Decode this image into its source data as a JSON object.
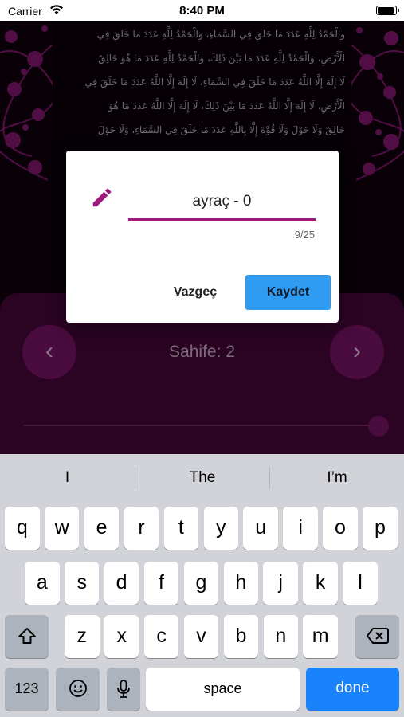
{
  "status_bar": {
    "carrier": "Carrier",
    "time": "8:40 PM"
  },
  "reader": {
    "arabic_lines": [
      "وَالْحَمْدُ لِلَّهِ عَدَدَ مَا خَلَقَ فِي السَّمَاءِ، وَالْحَمْدُ لِلَّهِ عَدَدَ مَا خَلَقَ فِي",
      "الْأَرْضِ، وَالْحَمْدُ لِلَّهِ عَدَدَ مَا بَيْنَ ذَلِكَ، وَالْحَمْدُ لِلَّهِ عَدَدَ مَا هُوَ خَالِقٌ",
      "لَا إِلَهَ إِلَّا اللَّهُ عَدَدَ مَا خَلَقَ فِي السَّمَاءِ، لَا إِلَهَ إِلَّا اللَّهُ عَدَدَ مَا خَلَقَ فِي",
      "الْأَرْضِ، لَا إِلَهَ إِلَّا اللَّهُ عَدَدَ مَا بَيْنَ ذَلِكَ، لَا إِلَهَ إِلَّا اللَّهُ عَدَدَ مَا هُوَ",
      "خَالِقٌ وَلَا حَوْلَ وَلَا قُوَّةَ إِلَّا بِاللَّهِ عَدَدَ مَا خَلَقَ فِي السَّمَاءِ، وَلَا حَوْلَ"
    ]
  },
  "panel": {
    "page_label": "Sahife: 2",
    "prev_icon": "‹",
    "next_icon": "›",
    "page_progress": 1.0
  },
  "dialog": {
    "input_value": "ayraç - 0",
    "char_count": "9/25",
    "cancel_label": "Vazgeç",
    "save_label": "Kaydet",
    "accent_color": "#9c1a7d",
    "save_color": "#2f9bf1"
  },
  "keyboard": {
    "suggestions": [
      "I",
      "The",
      "I’m"
    ],
    "row1": [
      "q",
      "w",
      "e",
      "r",
      "t",
      "y",
      "u",
      "i",
      "o",
      "p"
    ],
    "row2": [
      "a",
      "s",
      "d",
      "f",
      "g",
      "h",
      "j",
      "k",
      "l"
    ],
    "row3": [
      "z",
      "x",
      "c",
      "v",
      "b",
      "n",
      "m"
    ],
    "numbers_label": "123",
    "space_label": "space",
    "done_label": "done",
    "icons": {
      "shift": "shift-icon",
      "delete": "delete-icon",
      "emoji": "emoji-icon",
      "mic": "mic-icon"
    }
  }
}
